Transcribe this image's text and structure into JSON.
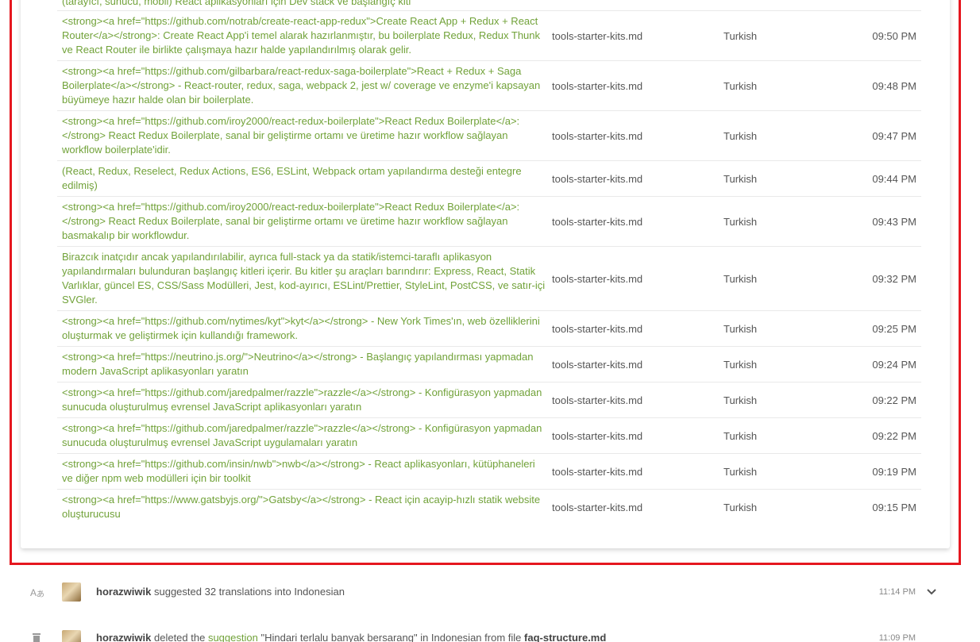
{
  "suggestions_table": {
    "partial_top_text": "(tarayıcı, sunucu, mobil) React aplikasyonları için Dev stack ve başlangıç kiti",
    "rows": [
      {
        "text": "<strong><a href=\"https://github.com/notrab/create-react-app-redux\">Create React App + Redux + React Router</a></strong>: Create React App'i temel alarak hazırlanmıştır, bu boilerplate Redux, Redux Thunk ve React Router ile birlikte çalışmaya hazır halde yapılandırılmış olarak gelir.",
        "file": "tools-starter-kits.md",
        "language": "Turkish",
        "time": "09:50 PM"
      },
      {
        "text": "<strong><a href=\"https://github.com/gilbarbara/react-redux-saga-boilerplate\">React + Redux + Saga Boilerplate</a></strong> - React-router, redux, saga, webpack 2, jest w/ coverage ve enzyme'i kapsayan büyümeye hazır halde olan bir boilerplate.",
        "file": "tools-starter-kits.md",
        "language": "Turkish",
        "time": "09:48 PM"
      },
      {
        "text": "<strong><a href=\"https://github.com/iroy2000/react-redux-boilerplate\">React Redux Boilerplate</a>:</strong> React Redux Boilerplate, sanal bir geliştirme ortamı ve üretime hazır workflow sağlayan workflow boilerplate'idir.",
        "file": "tools-starter-kits.md",
        "language": "Turkish",
        "time": "09:47 PM"
      },
      {
        "text": "(React, Redux, Reselect, Redux Actions, ES6, ESLint, Webpack ortam yapılandırma desteği entegre edilmiş)",
        "file": "tools-starter-kits.md",
        "language": "Turkish",
        "time": "09:44 PM"
      },
      {
        "text": "<strong><a href=\"https://github.com/iroy2000/react-redux-boilerplate\">React Redux Boilerplate</a>:</strong> React Redux Boilerplate, sanal bir geliştirme ortamı ve üretime hazır workflow sağlayan basmakalıp bir workflowdur.",
        "file": "tools-starter-kits.md",
        "language": "Turkish",
        "time": "09:43 PM"
      },
      {
        "text": "Birazcık inatçıdır ancak yapılandırılabilir, ayrıca full-stack ya da statik/istemci-taraflı aplikasyon yapılandırmaları bulunduran başlangıç kitleri içerir. Bu kitler şu araçları barındırır: Express, React, Statik Varlıklar, güncel ES, CSS/Sass Modülleri, Jest, kod-ayırıcı, ESLint/Prettier, StyleLint, PostCSS, ve satır-içi SVGler.",
        "file": "tools-starter-kits.md",
        "language": "Turkish",
        "time": "09:32 PM"
      },
      {
        "text": "<strong><a href=\"https://github.com/nytimes/kyt\">kyt</a></strong> - New York Times'ın, web özelliklerini oluşturmak ve geliştirmek için kullandığı framework.",
        "file": "tools-starter-kits.md",
        "language": "Turkish",
        "time": "09:25 PM"
      },
      {
        "text": "<strong><a href=\"https://neutrino.js.org/\">Neutrino</a></strong> - Başlangıç yapılandırması yapmadan modern JavaScript aplikasyonları yaratın",
        "file": "tools-starter-kits.md",
        "language": "Turkish",
        "time": "09:24 PM"
      },
      {
        "text": "<strong><a href=\"https://github.com/jaredpalmer/razzle\">razzle</a></strong> - Konfigürasyon yapmadan sunucuda oluşturulmuş evrensel JavaScript aplikasyonları yaratın",
        "file": "tools-starter-kits.md",
        "language": "Turkish",
        "time": "09:22 PM"
      },
      {
        "text": "<strong><a href=\"https://github.com/jaredpalmer/razzle\">razzle</a></strong> - Konfigürasyon yapmadan sunucuda oluşturulmuş evrensel JavaScript uygulamaları yaratın",
        "file": "tools-starter-kits.md",
        "language": "Turkish",
        "time": "09:22 PM"
      },
      {
        "text": "<strong><a href=\"https://github.com/insin/nwb\">nwb</a></strong> - React aplikasyonları, kütüphaneleri ve diğer npm web modülleri için bir toolkit",
        "file": "tools-starter-kits.md",
        "language": "Turkish",
        "time": "09:19 PM"
      },
      {
        "text": "<strong><a href=\"https://www.gatsbyjs.org/\">Gatsby</a></strong> - React için acayip-hızlı statik website oluşturucusu",
        "file": "tools-starter-kits.md",
        "language": "Turkish",
        "time": "09:15 PM"
      }
    ]
  },
  "activity_feed": [
    {
      "icon": "translate-icon",
      "user": "horazwiwik",
      "action": "suggested 32 translations into Indonesian",
      "time": "11:14 PM",
      "expandable": true
    },
    {
      "icon": "trash-icon",
      "user": "horazwiwik",
      "action_prefix": "deleted the",
      "link": "suggestion",
      "action_suffix": "\"Hindari terlalu banyak bersarang\" in Indonesian from file",
      "file": "faq-structure.md",
      "time": "11:09 PM"
    }
  ],
  "colors": {
    "suggestion_text": "#71a239",
    "highlight_border": "#e5171f"
  }
}
